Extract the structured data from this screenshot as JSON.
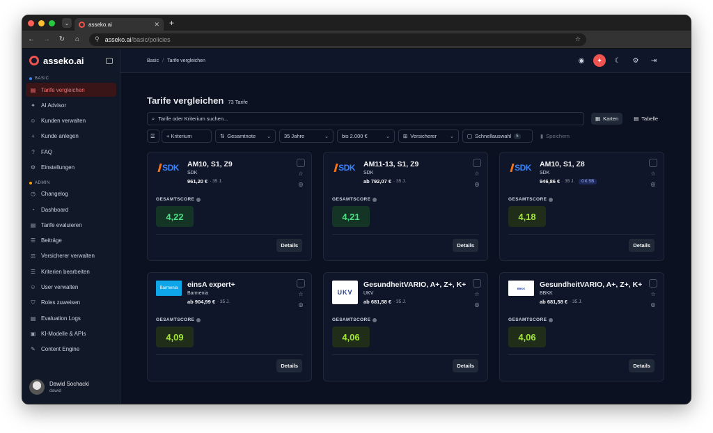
{
  "browser": {
    "tab_title": "asseko.ai",
    "url_host": "asseko.ai",
    "url_path": "/basic/policies"
  },
  "brand": {
    "name": "asseko.ai"
  },
  "sidebar": {
    "basic_label": "BASIC",
    "admin_label": "ADMIN",
    "basic_items": [
      {
        "label": "Tarife vergleichen",
        "icon": "document-icon",
        "glyph": "▤"
      },
      {
        "label": "AI Advisor",
        "icon": "sparkle-icon",
        "glyph": "✦"
      },
      {
        "label": "Kunden verwalten",
        "icon": "users-icon",
        "glyph": "☺"
      },
      {
        "label": "Kunde anlegen",
        "icon": "plus-icon",
        "glyph": "+"
      },
      {
        "label": "FAQ",
        "icon": "help-icon",
        "glyph": "?"
      },
      {
        "label": "Einstellungen",
        "icon": "gear-icon",
        "glyph": "⚙"
      }
    ],
    "admin_items": [
      {
        "label": "Changelog",
        "icon": "clock-icon",
        "glyph": "◷"
      },
      {
        "label": "Dashboard",
        "icon": "dashboard-icon",
        "glyph": "◔"
      },
      {
        "label": "Tarife evaluieren",
        "icon": "document-check-icon",
        "glyph": "▤"
      },
      {
        "label": "Beiträge",
        "icon": "list-icon",
        "glyph": "☰"
      },
      {
        "label": "Versicherer verwalten",
        "icon": "scale-icon",
        "glyph": "⚖"
      },
      {
        "label": "Kriterien bearbeiten",
        "icon": "list-check-icon",
        "glyph": "☰"
      },
      {
        "label": "User verwalten",
        "icon": "user-cog-icon",
        "glyph": "☺"
      },
      {
        "label": "Roles zuweisen",
        "icon": "shield-icon",
        "glyph": "⛉"
      },
      {
        "label": "Evaluation Logs",
        "icon": "file-text-icon",
        "glyph": "▤"
      },
      {
        "label": "KI-Modelle & APIs",
        "icon": "cpu-icon",
        "glyph": "▣"
      },
      {
        "label": "Content Engine",
        "icon": "edit-icon",
        "glyph": "✎"
      }
    ],
    "user": {
      "name": "Dawid Sochacki",
      "username": "dawid"
    }
  },
  "header": {
    "crumb_1": "Basic",
    "crumb_2": "Tarife vergleichen"
  },
  "page": {
    "title": "Tarife vergleichen",
    "count": "73 Tarife",
    "search_placeholder": "Tarife oder Kriterium suchen...",
    "view_cards": "Karten",
    "view_table": "Tabelle"
  },
  "filters": {
    "add_criterion": "+ Kriterium",
    "sort": "Gesamtnote",
    "age": "35 Jahre",
    "price": "bis 2.000 €",
    "insurer": "Versicherer",
    "quick": "Schnellauswahl",
    "quick_count": "5",
    "save": "Speichern"
  },
  "card_labels": {
    "score": "GESAMTSCORE",
    "details": "Details"
  },
  "cards": [
    {
      "title": "AM10, S1, Z9",
      "insurer": "SDK",
      "price": "961,20 €",
      "age": "· 35 J.",
      "score": "4,22",
      "logo": "SDK",
      "tone": "green"
    },
    {
      "title": "AM11-13, S1, Z9",
      "insurer": "SDK",
      "price": "ab 792,07 €",
      "age": "· 35 J.",
      "score": "4,21",
      "logo": "SDK",
      "tone": "green"
    },
    {
      "title": "AM10, S1, Z8",
      "insurer": "SDK",
      "price": "946,86 €",
      "age": "· 35 J.",
      "badge": "0 € SB",
      "score": "4,18",
      "logo": "SDK",
      "tone": "lime"
    },
    {
      "title": "einsA expert+",
      "insurer": "Barmenia",
      "price": "ab 904,99 €",
      "age": "· 35 J.",
      "score": "4,09",
      "logo": "Barmenia",
      "tone": "lime"
    },
    {
      "title": "GesundheitVARIO, A+, Z+, K+",
      "insurer": "UKV",
      "price": "ab 681,58 €",
      "age": "· 35 J.",
      "score": "4,06",
      "logo": "UKV",
      "tone": "lime"
    },
    {
      "title": "GesundheitVARIO, A+, Z+, K+",
      "insurer": "BBKK",
      "price": "ab 681,58 €",
      "age": "· 35 J.",
      "score": "4,06",
      "logo": "BBKK",
      "tone": "lime"
    }
  ],
  "colors": {
    "accent": "#ef5350",
    "score_green": "#4ade80",
    "score_lime": "#a3e635"
  }
}
